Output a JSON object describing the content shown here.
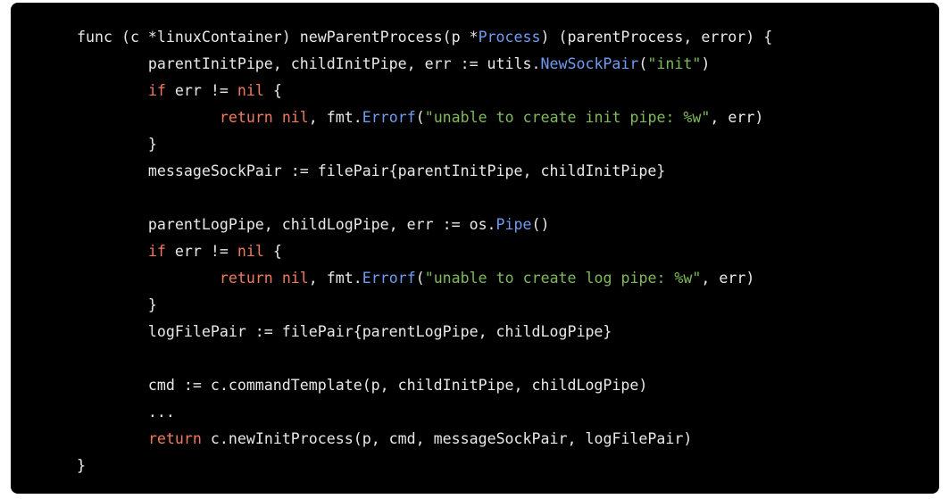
{
  "code": {
    "language": "go",
    "colors": {
      "background": "#000000",
      "text": "#e8e8e8",
      "keyword": "#f07a5c",
      "function_call": "#6f9cf0",
      "string": "#7fba5a"
    },
    "lines": [
      [
        {
          "t": "func (c *linuxContainer) newParentProcess(p *",
          "k": "plain"
        },
        {
          "t": "Process",
          "k": "fn"
        },
        {
          "t": ") (parentProcess, error) {",
          "k": "plain"
        }
      ],
      [
        {
          "t": "\tparentInitPipe, childInitPipe, err := utils.",
          "k": "plain"
        },
        {
          "t": "NewSockPair",
          "k": "fn"
        },
        {
          "t": "(",
          "k": "plain"
        },
        {
          "t": "\"init\"",
          "k": "str"
        },
        {
          "t": ")",
          "k": "plain"
        }
      ],
      [
        {
          "t": "\t",
          "k": "plain"
        },
        {
          "t": "if",
          "k": "kw"
        },
        {
          "t": " err != ",
          "k": "plain"
        },
        {
          "t": "nil",
          "k": "kw"
        },
        {
          "t": " {",
          "k": "plain"
        }
      ],
      [
        {
          "t": "\t\t",
          "k": "plain"
        },
        {
          "t": "return",
          "k": "kw"
        },
        {
          "t": " ",
          "k": "plain"
        },
        {
          "t": "nil",
          "k": "kw"
        },
        {
          "t": ", fmt.",
          "k": "plain"
        },
        {
          "t": "Errorf",
          "k": "fn"
        },
        {
          "t": "(",
          "k": "plain"
        },
        {
          "t": "\"unable to create init pipe: %w\"",
          "k": "str"
        },
        {
          "t": ", err)",
          "k": "plain"
        }
      ],
      [
        {
          "t": "\t}",
          "k": "plain"
        }
      ],
      [
        {
          "t": "\tmessageSockPair := filePair{parentInitPipe, childInitPipe}",
          "k": "plain"
        }
      ],
      [
        {
          "t": "",
          "k": "plain"
        }
      ],
      [
        {
          "t": "\tparentLogPipe, childLogPipe, err := os.",
          "k": "plain"
        },
        {
          "t": "Pipe",
          "k": "fn"
        },
        {
          "t": "()",
          "k": "plain"
        }
      ],
      [
        {
          "t": "\t",
          "k": "plain"
        },
        {
          "t": "if",
          "k": "kw"
        },
        {
          "t": " err != ",
          "k": "plain"
        },
        {
          "t": "nil",
          "k": "kw"
        },
        {
          "t": " {",
          "k": "plain"
        }
      ],
      [
        {
          "t": "\t\t",
          "k": "plain"
        },
        {
          "t": "return",
          "k": "kw"
        },
        {
          "t": " ",
          "k": "plain"
        },
        {
          "t": "nil",
          "k": "kw"
        },
        {
          "t": ", fmt.",
          "k": "plain"
        },
        {
          "t": "Errorf",
          "k": "fn"
        },
        {
          "t": "(",
          "k": "plain"
        },
        {
          "t": "\"unable to create log pipe: %w\"",
          "k": "str"
        },
        {
          "t": ", err)",
          "k": "plain"
        }
      ],
      [
        {
          "t": "\t}",
          "k": "plain"
        }
      ],
      [
        {
          "t": "\tlogFilePair := filePair{parentLogPipe, childLogPipe}",
          "k": "plain"
        }
      ],
      [
        {
          "t": "",
          "k": "plain"
        }
      ],
      [
        {
          "t": "\tcmd := c.commandTemplate(p, childInitPipe, childLogPipe)",
          "k": "plain"
        }
      ],
      [
        {
          "t": "\t...",
          "k": "plain"
        }
      ],
      [
        {
          "t": "\t",
          "k": "plain"
        },
        {
          "t": "return",
          "k": "kw"
        },
        {
          "t": " c.newInitProcess(p, cmd, messageSockPair, logFilePair)",
          "k": "plain"
        }
      ],
      [
        {
          "t": "}",
          "k": "plain"
        }
      ]
    ]
  }
}
